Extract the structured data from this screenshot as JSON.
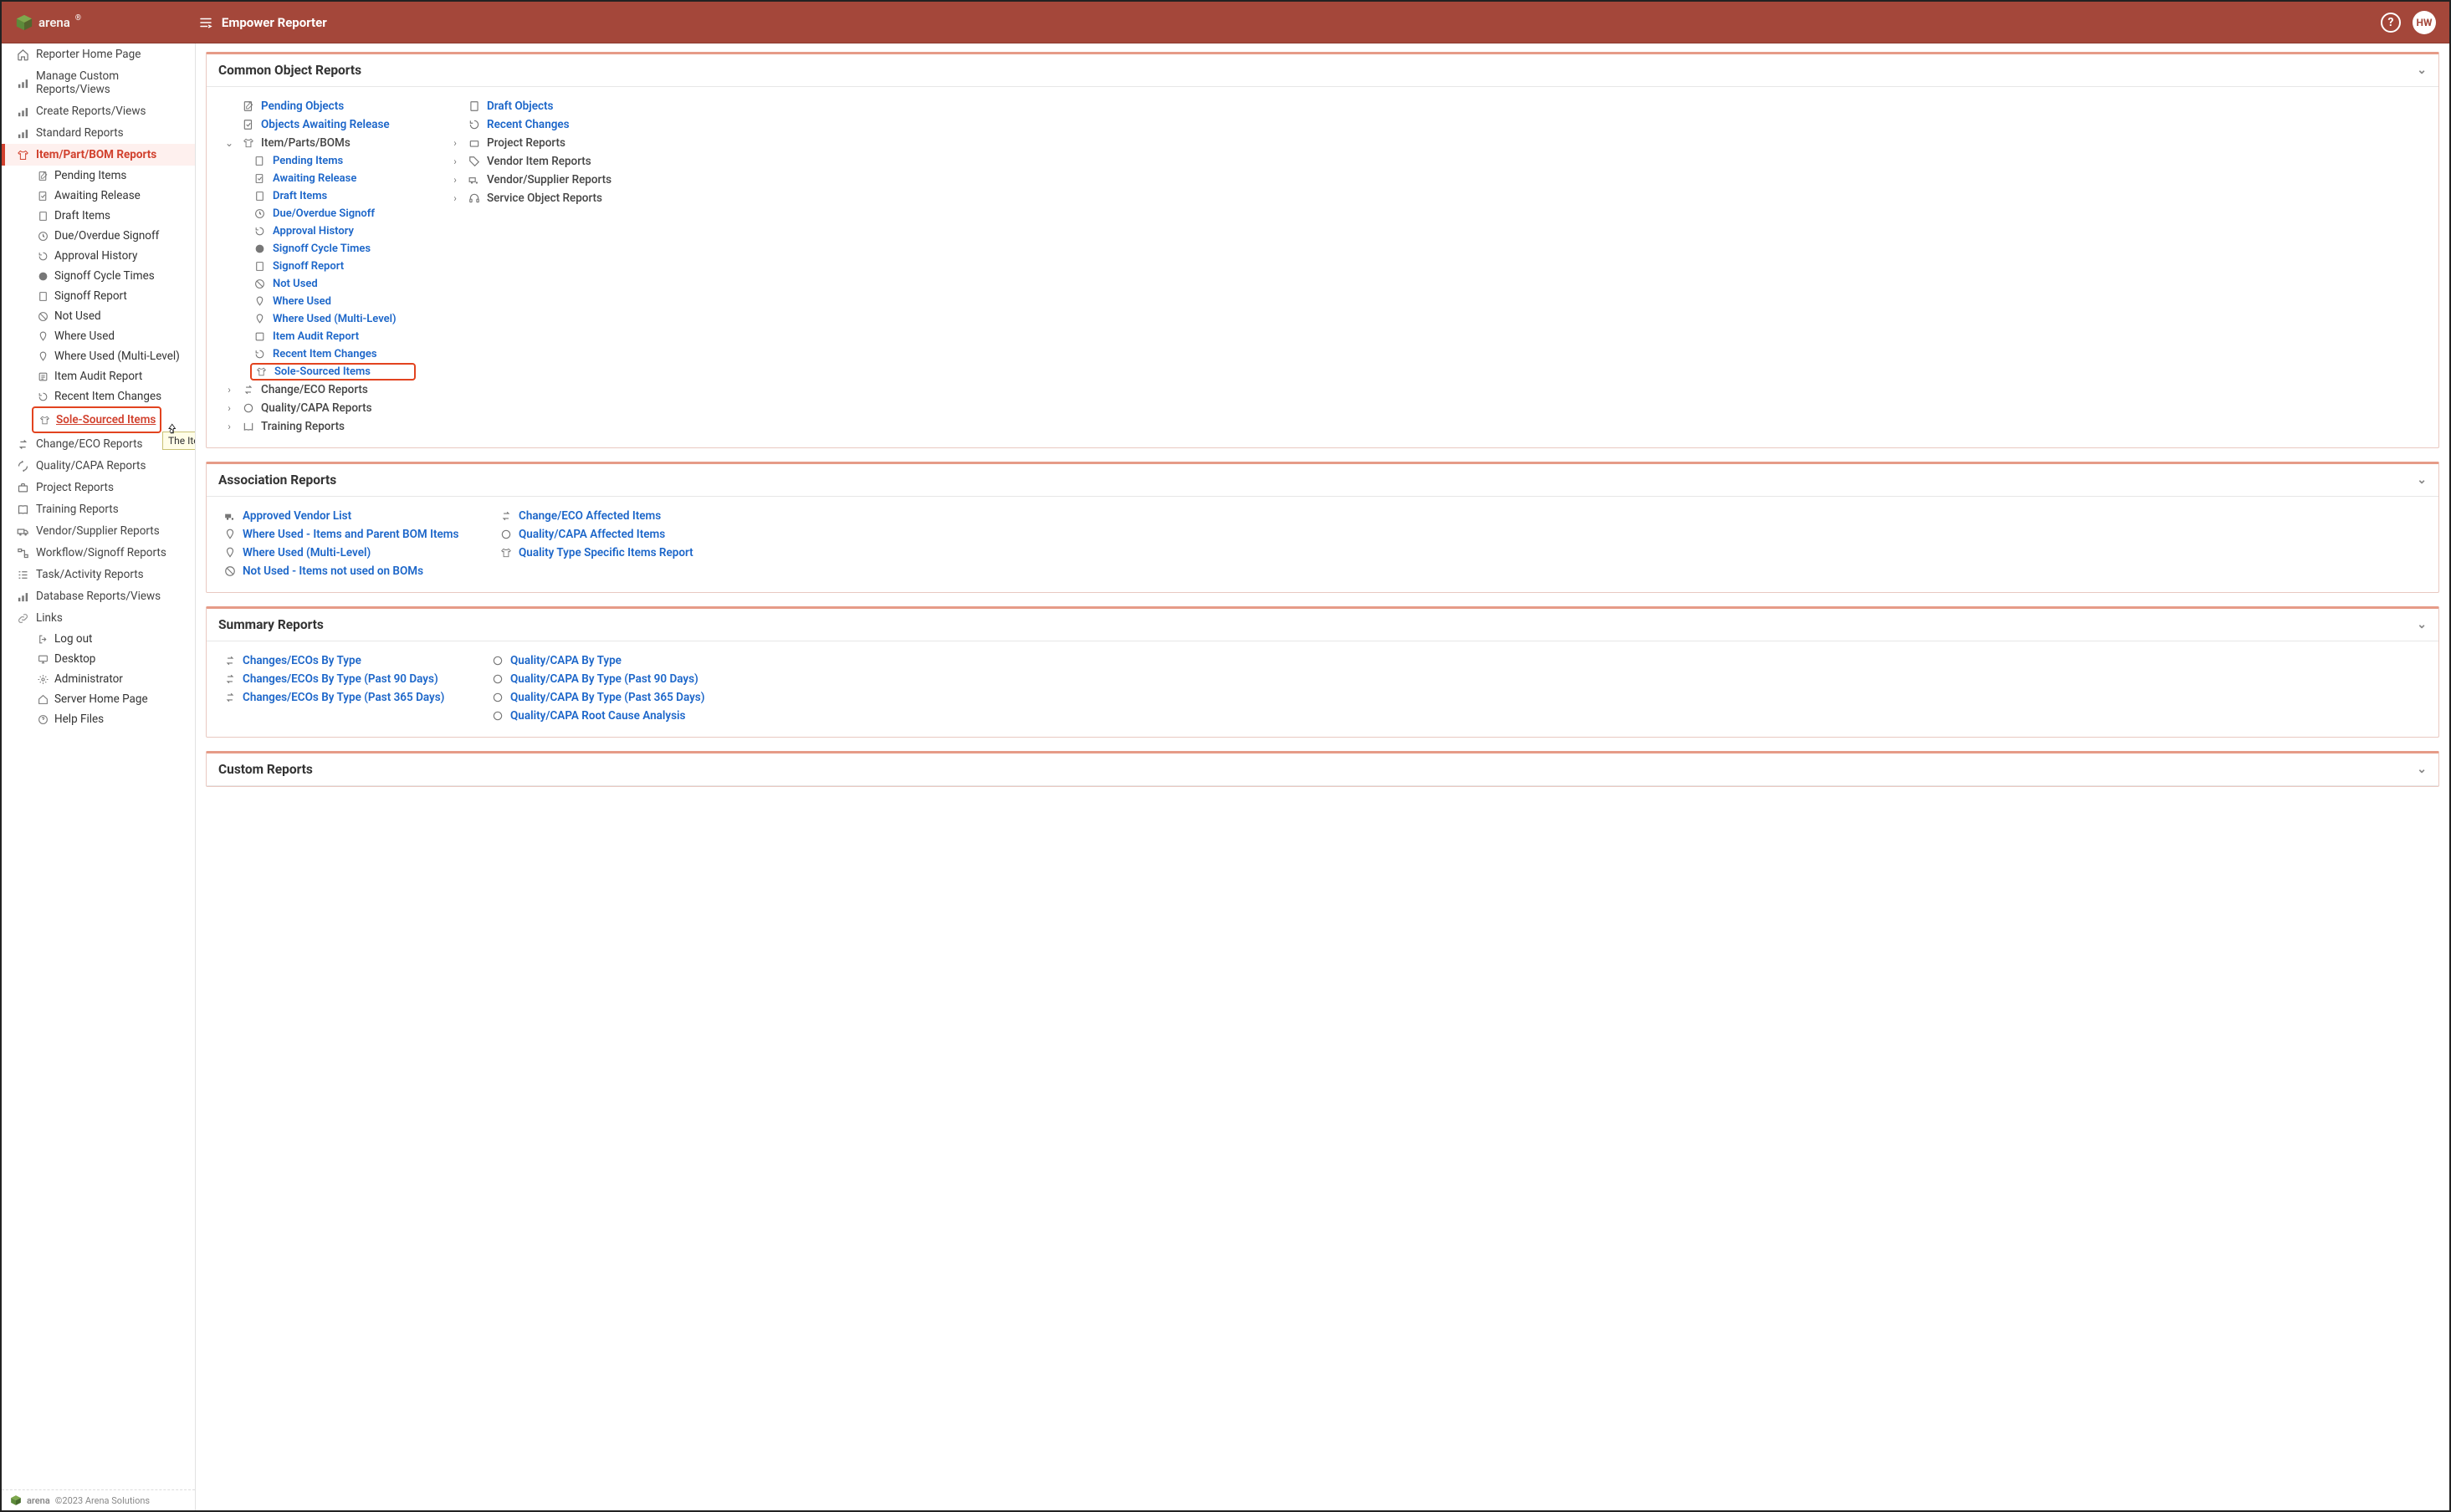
{
  "header": {
    "brand": "arena",
    "title": "Empower Reporter",
    "avatar_initials": "HW"
  },
  "sidebar": {
    "items": [
      {
        "label": "Reporter Home Page"
      },
      {
        "label": "Manage Custom Reports/Views"
      },
      {
        "label": "Create Reports/Views"
      },
      {
        "label": "Standard Reports"
      },
      {
        "label": "Item/Part/BOM Reports",
        "active": true
      },
      {
        "label": "Change/ECO Reports"
      },
      {
        "label": "Quality/CAPA Reports"
      },
      {
        "label": "Project Reports"
      },
      {
        "label": "Training Reports"
      },
      {
        "label": "Vendor/Supplier Reports"
      },
      {
        "label": "Workflow/Signoff Reports"
      },
      {
        "label": "Task/Activity Reports"
      },
      {
        "label": "Database Reports/Views"
      },
      {
        "label": "Links"
      }
    ],
    "sub_items": [
      {
        "label": "Pending Items"
      },
      {
        "label": "Awaiting Release"
      },
      {
        "label": "Draft Items"
      },
      {
        "label": "Due/Overdue Signoff"
      },
      {
        "label": "Approval History"
      },
      {
        "label": "Signoff Cycle Times"
      },
      {
        "label": "Signoff Report"
      },
      {
        "label": "Not Used"
      },
      {
        "label": "Where Used"
      },
      {
        "label": "Where Used (Multi-Level)"
      },
      {
        "label": "Item Audit Report"
      },
      {
        "label": "Recent Item Changes"
      },
      {
        "label": "Sole-Sourced Items"
      }
    ],
    "links": [
      {
        "label": "Log out"
      },
      {
        "label": "Desktop"
      },
      {
        "label": "Administrator"
      },
      {
        "label": "Server Home Page"
      },
      {
        "label": "Help Files"
      }
    ],
    "tooltip": "The Items with only one vendor",
    "footer_brand": "arena",
    "footer_copy": "©2023 Arena Solutions"
  },
  "common": {
    "heading": "Common Object Reports",
    "col1": {
      "pending_objects": "Pending Objects",
      "awaiting_release": "Objects Awaiting Release",
      "group": "Item/Parts/BOMs",
      "children": [
        "Pending Items",
        "Awaiting Release",
        "Draft Items",
        "Due/Overdue Signoff",
        "Approval History",
        "Signoff Cycle Times",
        "Signoff Report",
        "Not Used",
        "Where Used",
        "Where Used (Multi-Level)",
        "Item Audit Report",
        "Recent Item Changes",
        "Sole-Sourced Items"
      ],
      "change_eco": "Change/ECO Reports",
      "quality_capa": "Quality/CAPA Reports",
      "training": "Training Reports"
    },
    "col2": {
      "draft_objects": "Draft Objects",
      "recent_changes": "Recent Changes",
      "project": "Project Reports",
      "vendor_item": "Vendor Item Reports",
      "vendor_supplier": "Vendor/Supplier Reports",
      "service": "Service Object Reports"
    }
  },
  "association": {
    "heading": "Association Reports",
    "col1": [
      "Approved Vendor List",
      "Where Used - Items and Parent BOM Items",
      "Where Used (Multi-Level)",
      "Not Used - Items not used on BOMs"
    ],
    "col2": [
      "Change/ECO Affected Items",
      "Quality/CAPA Affected Items",
      "Quality Type Specific Items Report"
    ]
  },
  "summary": {
    "heading": "Summary Reports",
    "col1": [
      "Changes/ECOs By Type",
      "Changes/ECOs By Type (Past 90 Days)",
      "Changes/ECOs By Type (Past 365 Days)"
    ],
    "col2": [
      "Quality/CAPA By Type",
      "Quality/CAPA By Type (Past 90 Days)",
      "Quality/CAPA By Type (Past 365 Days)",
      "Quality/CAPA Root Cause Analysis"
    ]
  },
  "custom": {
    "heading": "Custom Reports"
  }
}
